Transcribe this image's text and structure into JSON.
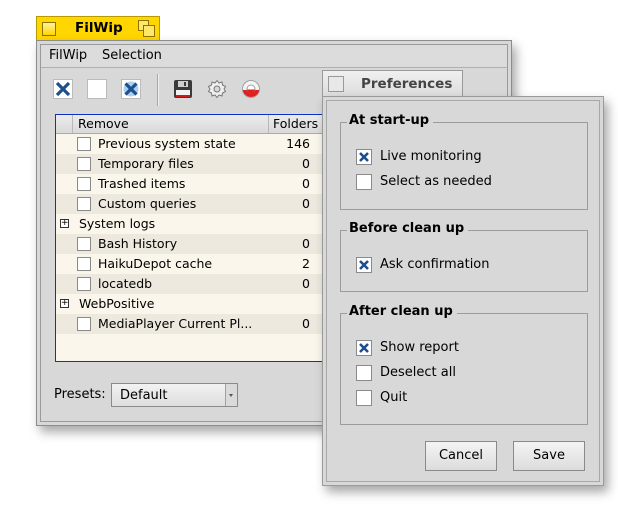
{
  "main_window": {
    "title": "FilWip",
    "menu": [
      "FilWip",
      "Selection"
    ],
    "toolbar": {
      "select_all": "select-all-icon",
      "select_none": "select-none-icon",
      "invert_selection": "invert-selection-icon",
      "save": "save-icon",
      "settings": "gear-icon",
      "help": "help-lifebuoy-icon"
    },
    "list": {
      "columns": [
        "Remove",
        "Folders"
      ],
      "rows": [
        {
          "type": "item",
          "label": "Previous system state",
          "folders": "146",
          "checked": false
        },
        {
          "type": "item",
          "label": "Temporary files",
          "folders": "0",
          "checked": false
        },
        {
          "type": "item",
          "label": "Trashed items",
          "folders": "0",
          "checked": false
        },
        {
          "type": "item",
          "label": "Custom queries",
          "folders": "0",
          "checked": false
        },
        {
          "type": "group",
          "label": "System logs",
          "expand_symbol": "+"
        },
        {
          "type": "item",
          "label": "Bash History",
          "folders": "0",
          "checked": false
        },
        {
          "type": "item",
          "label": "HaikuDepot cache",
          "folders": "2",
          "checked": false
        },
        {
          "type": "item",
          "label": "locatedb",
          "folders": "0",
          "checked": false
        },
        {
          "type": "group",
          "label": "WebPositive",
          "expand_symbol": "+"
        },
        {
          "type": "item",
          "label": "MediaPlayer Current Pl...",
          "folders": "0",
          "checked": false
        }
      ]
    },
    "presets": {
      "label": "Presets:",
      "value": "Default"
    }
  },
  "preferences": {
    "title": "Preferences",
    "groups": [
      {
        "title": "At start-up",
        "options": [
          {
            "label": "Live monitoring",
            "checked": true
          },
          {
            "label": "Select as needed",
            "checked": false
          }
        ]
      },
      {
        "title": "Before clean up",
        "options": [
          {
            "label": "Ask confirmation",
            "checked": true
          }
        ]
      },
      {
        "title": "After clean up",
        "options": [
          {
            "label": "Show report",
            "checked": true
          },
          {
            "label": "Deselect all",
            "checked": false
          },
          {
            "label": "Quit",
            "checked": false
          }
        ]
      }
    ],
    "buttons": {
      "cancel": "Cancel",
      "save": "Save"
    }
  },
  "colors": {
    "title_tab_active": "#ffd600",
    "check_mark": "#1e4f8c",
    "list_border": "#1030c0"
  }
}
